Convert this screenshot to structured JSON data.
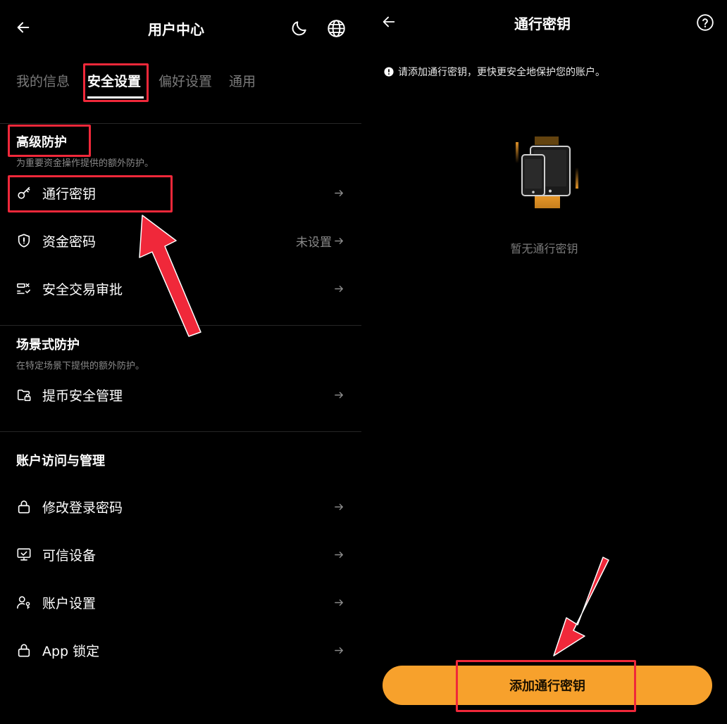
{
  "left": {
    "header": {
      "title": "用户中心"
    },
    "tabs": [
      {
        "label": "我的信息"
      },
      {
        "label": "安全设置"
      },
      {
        "label": "偏好设置"
      },
      {
        "label": "通用"
      }
    ],
    "sections": [
      {
        "title": "高级防护",
        "description": "为重要资金操作提供的额外防护。",
        "items": [
          {
            "label": "通行密钥",
            "value": "",
            "icon": "key-icon"
          },
          {
            "label": "资金密码",
            "value": "未设置",
            "icon": "shield-icon"
          },
          {
            "label": "安全交易审批",
            "value": "",
            "icon": "checklist-icon"
          }
        ]
      },
      {
        "title": "场景式防护",
        "description": "在特定场景下提供的额外防护。",
        "items": [
          {
            "label": "提币安全管理",
            "value": "",
            "icon": "folder-lock-icon"
          }
        ]
      },
      {
        "title": "账户访问与管理",
        "description": "",
        "items": [
          {
            "label": "修改登录密码",
            "value": "",
            "icon": "lock-icon"
          },
          {
            "label": "可信设备",
            "value": "",
            "icon": "monitor-check-icon"
          },
          {
            "label": "账户设置",
            "value": "",
            "icon": "user-settings-icon"
          },
          {
            "label": "App 锁定",
            "value": "",
            "icon": "lock-icon"
          }
        ]
      }
    ]
  },
  "right": {
    "header": {
      "title": "通行密钥"
    },
    "notice": "请添加通行密钥，更快更安全地保护您的账户。",
    "empty_text": "暂无通行密钥",
    "cta_label": "添加通行密钥"
  },
  "colors": {
    "background": "#000000",
    "accent": "#f7a12c",
    "annotation": "#f0283a",
    "muted_text": "#8a8a8a"
  }
}
